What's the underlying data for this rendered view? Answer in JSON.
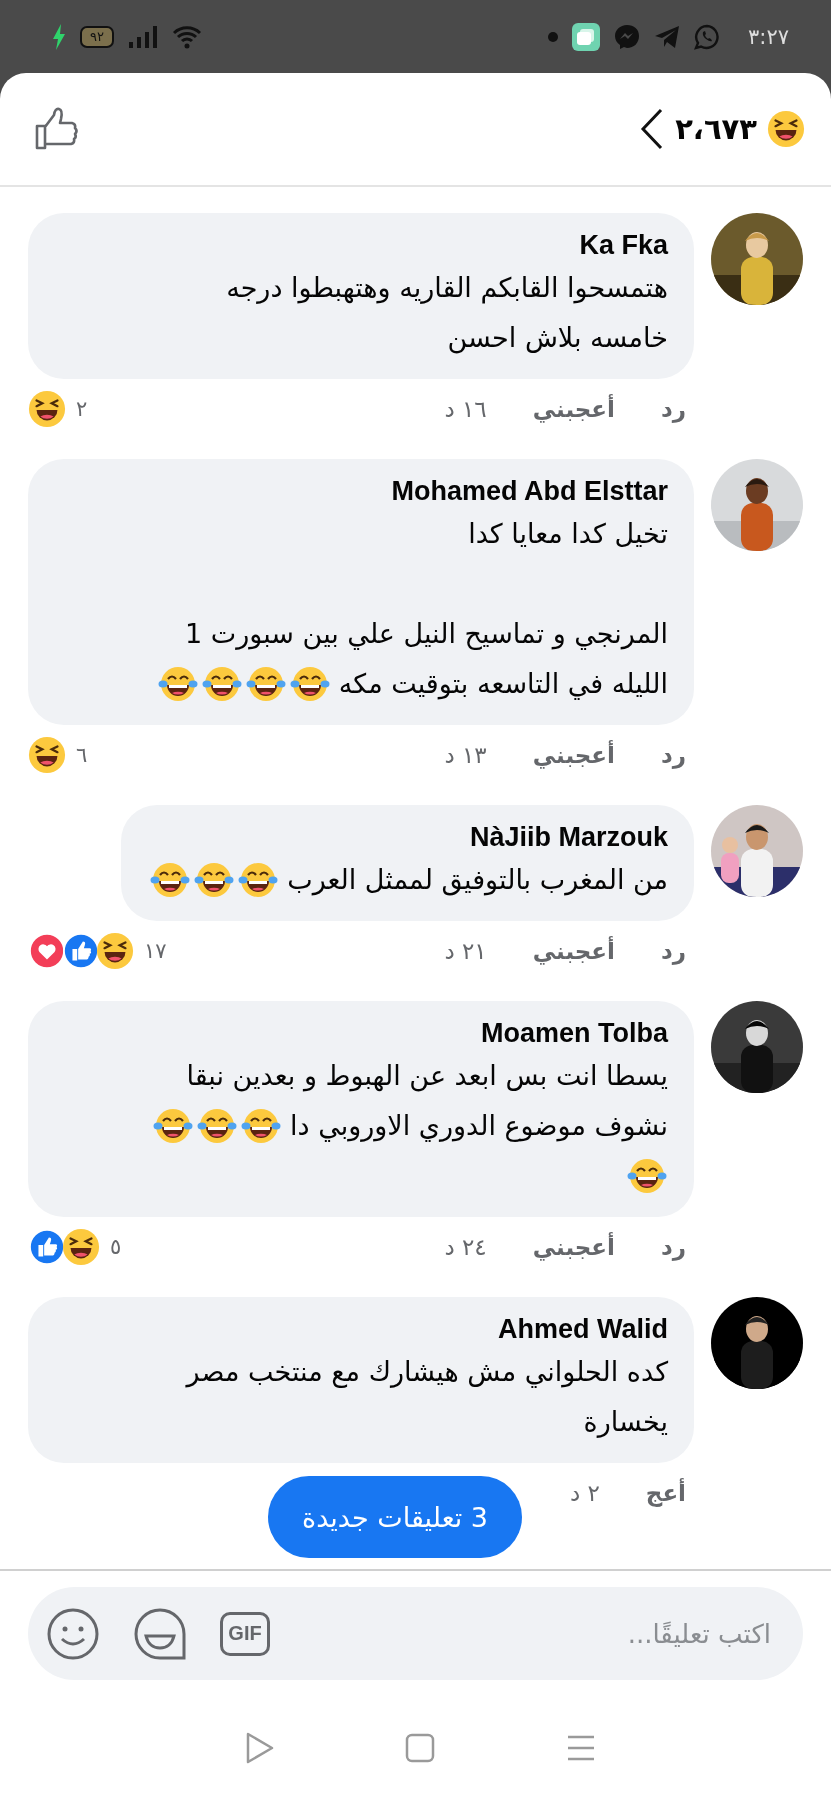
{
  "status_bar": {
    "time": "٣:٢٧",
    "battery": "٩٢"
  },
  "header": {
    "reaction": {
      "kind": "haha"
    },
    "count": "٢،٦٧٣"
  },
  "comments": [
    {
      "author": "Ka Fka",
      "paragraphs": [
        {
          "lines": [
            {
              "text": "هتمسحوا القابكم القاريه وهتهبطوا درجه"
            },
            {
              "text": "خامسه بلاش احسن"
            }
          ]
        }
      ],
      "time": "١٦ د",
      "like": "أعجبني",
      "reply": "رد",
      "reactions": [
        {
          "kind": "haha"
        }
      ],
      "reaction_count": "٢"
    },
    {
      "author": "Mohamed Abd Elsttar",
      "paragraphs": [
        {
          "lines": [
            {
              "text": "تخيل كدا معايا كدا"
            }
          ]
        },
        {
          "lines": [
            {
              "text": "المرنجي و تماسيح النيل علي بين سبورت 1"
            },
            {
              "text": "الليله في التاسعه بتوقيت مكه",
              "emojis": [
                {
                  "kind": "tears_of_joy"
                },
                {
                  "kind": "tears_of_joy"
                },
                {
                  "kind": "tears_of_joy"
                },
                {
                  "kind": "tears_of_joy"
                }
              ]
            }
          ]
        }
      ],
      "time": "١٣ د",
      "like": "أعجبني",
      "reply": "رد",
      "reactions": [
        {
          "kind": "haha"
        }
      ],
      "reaction_count": "٦"
    },
    {
      "author": "NàJiib Marzouk",
      "paragraphs": [
        {
          "lines": [
            {
              "text": "من المغرب بالتوفيق لممثل العرب",
              "emojis": [
                {
                  "kind": "tears_of_joy"
                },
                {
                  "kind": "tears_of_joy"
                },
                {
                  "kind": "tears_of_joy"
                }
              ]
            }
          ]
        }
      ],
      "time": "٢١ د",
      "like": "أعجبني",
      "reply": "رد",
      "reactions": [
        {
          "kind": "love"
        },
        {
          "kind": "like"
        },
        {
          "kind": "haha"
        }
      ],
      "reaction_count": "١٧"
    },
    {
      "author": "Moamen Tolba",
      "paragraphs": [
        {
          "lines": [
            {
              "text": "يسطا انت بس ابعد عن الهبوط و بعدين نبقا"
            },
            {
              "text": "نشوف موضوع الدوري الاوروبي دا",
              "emojis": [
                {
                  "kind": "tears_of_joy"
                },
                {
                  "kind": "tears_of_joy"
                },
                {
                  "kind": "tears_of_joy"
                }
              ]
            },
            {
              "emojis": [
                {
                  "kind": "tears_of_joy"
                }
              ]
            }
          ]
        }
      ],
      "time": "٢٤ د",
      "like": "أعجبني",
      "reply": "رد",
      "reactions": [
        {
          "kind": "like"
        },
        {
          "kind": "haha"
        }
      ],
      "reaction_count": "٥"
    },
    {
      "author": "Ahmed Walid",
      "paragraphs": [
        {
          "lines": [
            {
              "text": "كده الحلواني مش هيشارك مع منتخب مصر"
            },
            {
              "text": "يخسارة"
            }
          ]
        }
      ],
      "time": "٢ د",
      "like": "أعج"
    }
  ],
  "new_comments": "3 تعليقات جديدة",
  "composer": {
    "placeholder": "اكتب تعليقًا...",
    "gif": "GIF"
  }
}
